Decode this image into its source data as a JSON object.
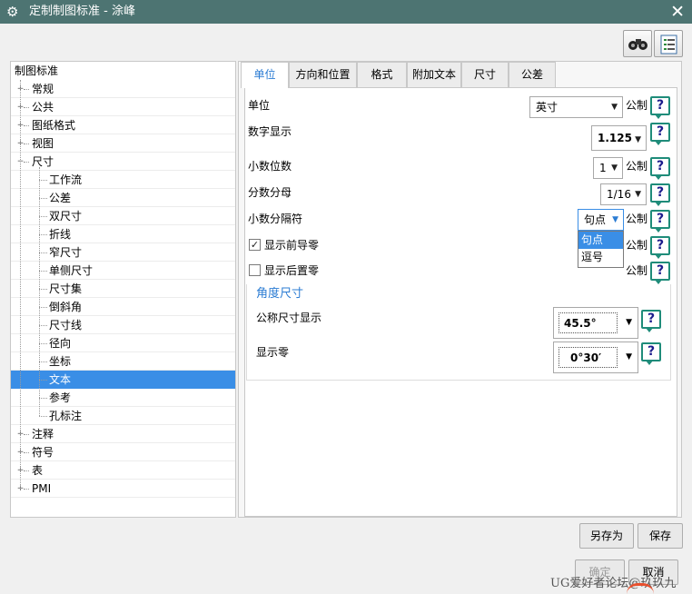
{
  "window": {
    "title": "定制制图标准 - 涂峰",
    "close_glyph": "✕"
  },
  "toolbar": {
    "icons": [
      "binoculars-icon",
      "document-list-icon"
    ]
  },
  "tree": {
    "root": "制图标准",
    "nodes": [
      {
        "label": "常规",
        "expander": "+"
      },
      {
        "label": "公共",
        "expander": "+"
      },
      {
        "label": "图纸格式",
        "expander": "+"
      },
      {
        "label": "视图",
        "expander": "+"
      },
      {
        "label": "尺寸",
        "expander": "−"
      },
      {
        "label": "工作流"
      },
      {
        "label": "公差"
      },
      {
        "label": "双尺寸"
      },
      {
        "label": "折线"
      },
      {
        "label": "窄尺寸"
      },
      {
        "label": "单侧尺寸"
      },
      {
        "label": "尺寸集"
      },
      {
        "label": "倒斜角"
      },
      {
        "label": "尺寸线"
      },
      {
        "label": "径向"
      },
      {
        "label": "坐标"
      },
      {
        "label": "文本",
        "selected": true
      },
      {
        "label": "参考"
      },
      {
        "label": "孔标注"
      },
      {
        "label": "注释",
        "expander": "+"
      },
      {
        "label": "符号",
        "expander": "+"
      },
      {
        "label": "表",
        "expander": "+"
      },
      {
        "label": "PMI",
        "expander": "+"
      }
    ]
  },
  "tabs": [
    "单位",
    "方向和位置",
    "格式",
    "附加文本",
    "尺寸",
    "公差"
  ],
  "active_tab": "单位",
  "form": {
    "unit_label": "单位",
    "unit_value": "英寸",
    "metric_label": "公制",
    "digits_label": "数字显示",
    "digits_value": "1.125",
    "decimals_label": "小数位数",
    "decimals_value": "1",
    "fraction_label": "分数分母",
    "fraction_value": "1/16",
    "separator_label": "小数分隔符",
    "separator_value": "句点",
    "separator_options": [
      "句点",
      "逗号"
    ],
    "leading_zero_label": "显示前导零",
    "leading_zero_checked": true,
    "trailing_zero_label": "显示后置零",
    "trailing_zero_checked": false,
    "angle_section": "角度尺寸",
    "nominal_label": "公称尺寸显示",
    "nominal_value": "45.5°",
    "show_zero_label": "显示零",
    "show_zero_value": "0°30′",
    "help_glyph": "?",
    "check_glyph": "✓",
    "dropdown_arrow": "▼"
  },
  "buttons": {
    "save_as": "另存为",
    "save": "保存",
    "ok": "确定",
    "cancel": "取消"
  },
  "watermark": "UG爱好者论坛@玖玖九",
  "colors": {
    "titlebar": "#4d7472",
    "accent": "#2b7cd3",
    "selection": "#3a8ee6"
  }
}
